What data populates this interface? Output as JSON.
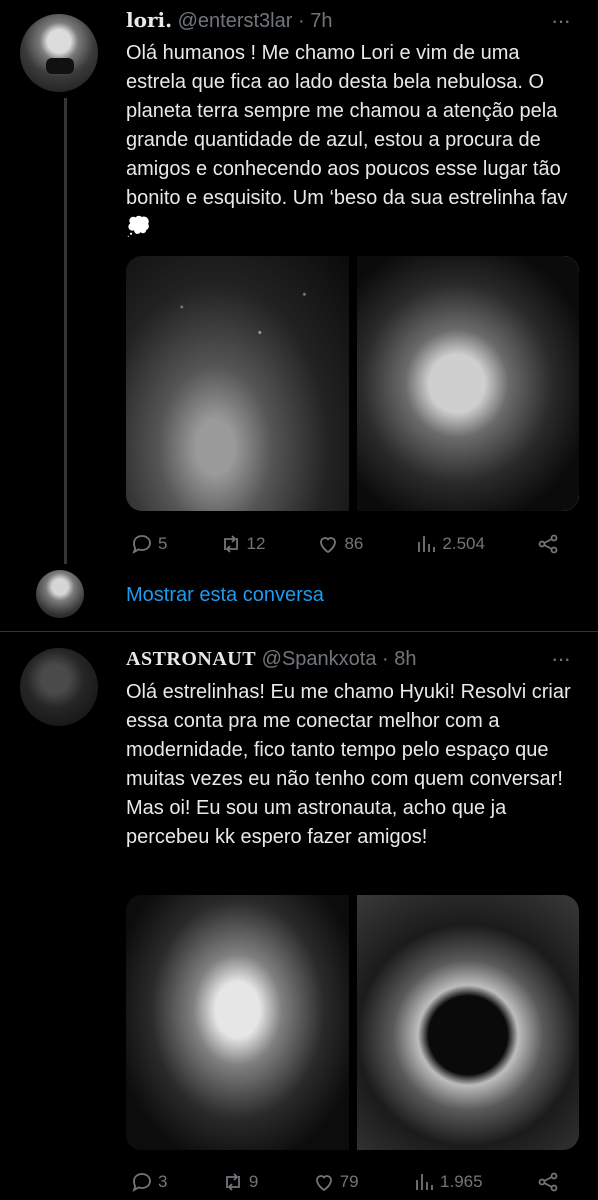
{
  "tweet1": {
    "name": "lori.",
    "handle": "@enterst3lar",
    "separator": "·",
    "time": "7h",
    "more": "···",
    "text": "Olá humanos ! Me chamo Lori e vim de uma estrela que fica ao lado desta bela nebulosa. O planeta terra sempre me chamou a atenção pela grande quantidade de azul, estou a procura de amigos e conhecendo aos poucos esse lugar tão bonito e esquisito. Um ‘beso da sua estrelinha fav 💭",
    "media": [
      {
        "icon": "nebula-photo"
      },
      {
        "icon": "portrait-photo"
      }
    ],
    "actions": {
      "replies": "5",
      "retweets": "12",
      "likes": "86",
      "views": "2.504"
    }
  },
  "thread": {
    "show_conversation": "Mostrar esta conversa"
  },
  "tweet2": {
    "name": "ASTRONAUT",
    "handle": "@Spankxota",
    "separator": "·",
    "time": "8h",
    "more": "···",
    "text": "Olá estrelinhas! Eu me chamo Hyuki! Resolvi criar essa conta pra me conectar melhor com a modernidade, fico tanto tempo pelo espaço que muitas vezes eu não tenho com quem conversar! Mas oi! Eu sou um astronauta, acho que ja percebeu kk espero fazer amigos!",
    "media": [
      {
        "icon": "portrait-photo"
      },
      {
        "icon": "astronaut-helmet-photo"
      }
    ],
    "actions": {
      "replies": "3",
      "retweets": "9",
      "likes": "79",
      "views": "1.965"
    }
  },
  "colors": {
    "background": "#000000",
    "text": "#e7e9ea",
    "muted": "#71767b",
    "link": "#1d9bf0",
    "divider": "#2f3336"
  }
}
